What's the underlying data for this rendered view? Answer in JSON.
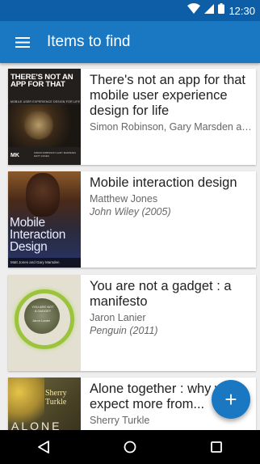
{
  "status_bar": {
    "time": "12:30",
    "icons": [
      "wifi-icon",
      "signal-icon",
      "battery-icon"
    ]
  },
  "app_bar": {
    "menu_icon": "menu-icon",
    "title": "Items to find",
    "color": "#1a78c2"
  },
  "books": [
    {
      "title": "There's not an app for that mobile user experience design for life",
      "author": "Simon Robinson, Gary Marsden and Matt Jones",
      "publisher": "",
      "cover": {
        "title": "THERE'S NOT AN APP FOR THAT",
        "subtitle": "MOBILE USER EXPERIENCE DESIGN FOR LIFE",
        "authors": "SIMON ROBINSON GARY MARSDEN MATT JONES",
        "logo": "MK"
      }
    },
    {
      "title": "Mobile interaction design",
      "author": "Matthew Jones",
      "publisher": "John Wiley (2005)",
      "cover": {
        "title": "Mobile Interaction Design",
        "authors": "Matt Jones and Gary Marsden"
      }
    },
    {
      "title": "You are not a gadget : a manifesto",
      "author": "Jaron Lanier",
      "publisher": "Penguin (2011)",
      "cover": {
        "title": "YOU ARE NOT A GADGET",
        "author": "Jaron Lanier"
      }
    },
    {
      "title": "Alone together : why we expect more from...",
      "author": "Sherry Turkle",
      "publisher": "",
      "cover": {
        "author": "Sherry Turkle",
        "title": "ALONE"
      }
    }
  ],
  "fab": {
    "icon": "plus-icon",
    "label": "+"
  },
  "nav_bar": {
    "icons": [
      "back-icon",
      "home-icon",
      "recents-icon"
    ]
  }
}
